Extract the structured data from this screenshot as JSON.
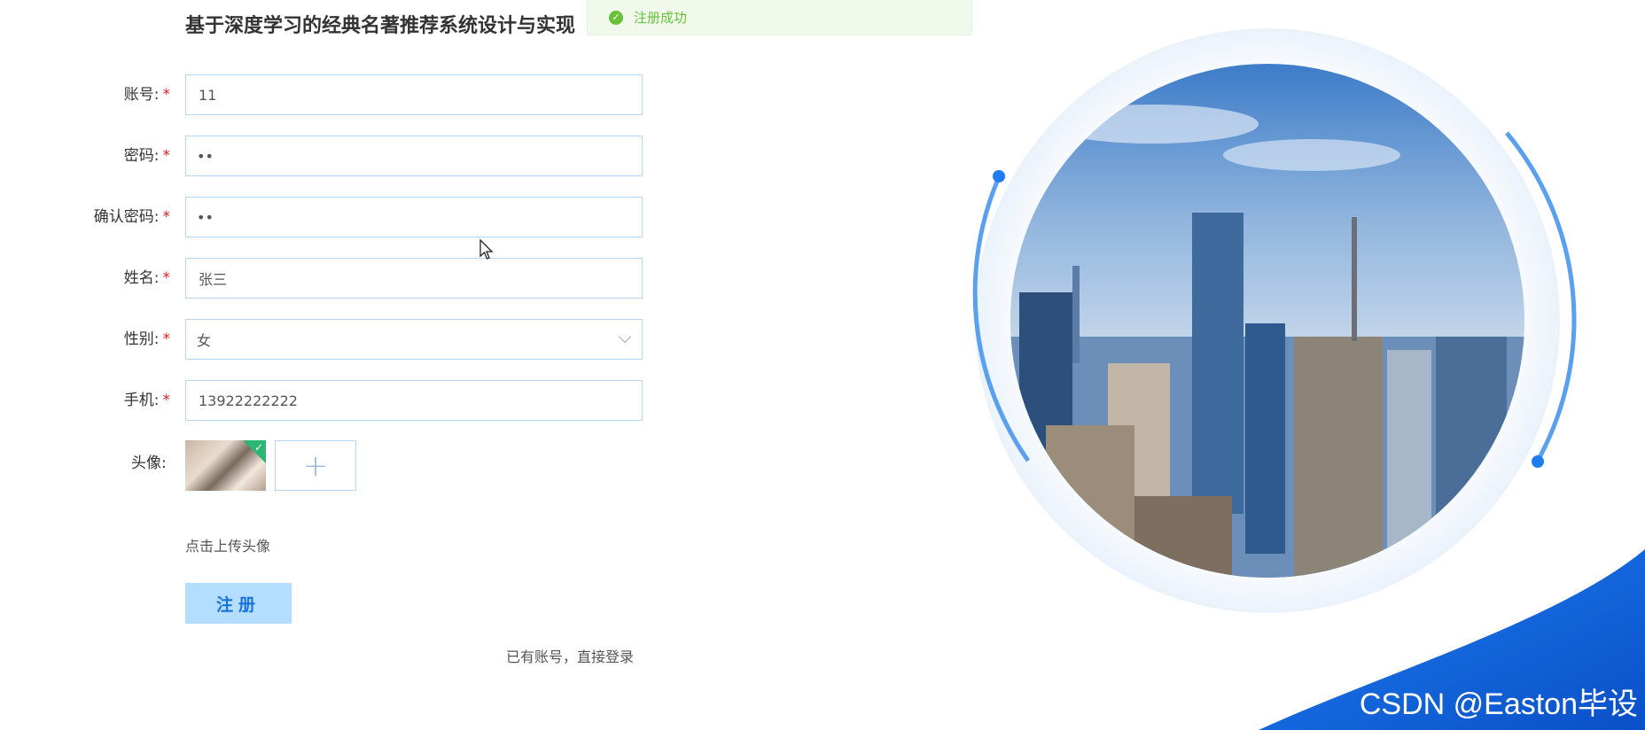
{
  "toast": {
    "message": "注册成功"
  },
  "title": "基于深度学习的经典名著推荐系统设计与实现",
  "form": {
    "account": {
      "label": "账号:",
      "value": "11"
    },
    "password": {
      "label": "密码:",
      "value": "••"
    },
    "confirm": {
      "label": "确认密码:",
      "value": "••"
    },
    "name": {
      "label": "姓名:",
      "value": "张三"
    },
    "gender": {
      "label": "性别:",
      "value": "女"
    },
    "phone": {
      "label": "手机:",
      "value": "13922222222"
    },
    "avatar": {
      "label": "头像:"
    },
    "required_mark": "*"
  },
  "upload_tip": "点击上传头像",
  "register_button": "注册",
  "login_link": "已有账号，直接登录",
  "watermark": "CSDN @Easton毕设",
  "colors": {
    "accent": "#1a73d9",
    "success": "#67c23a",
    "required": "#e02020"
  }
}
